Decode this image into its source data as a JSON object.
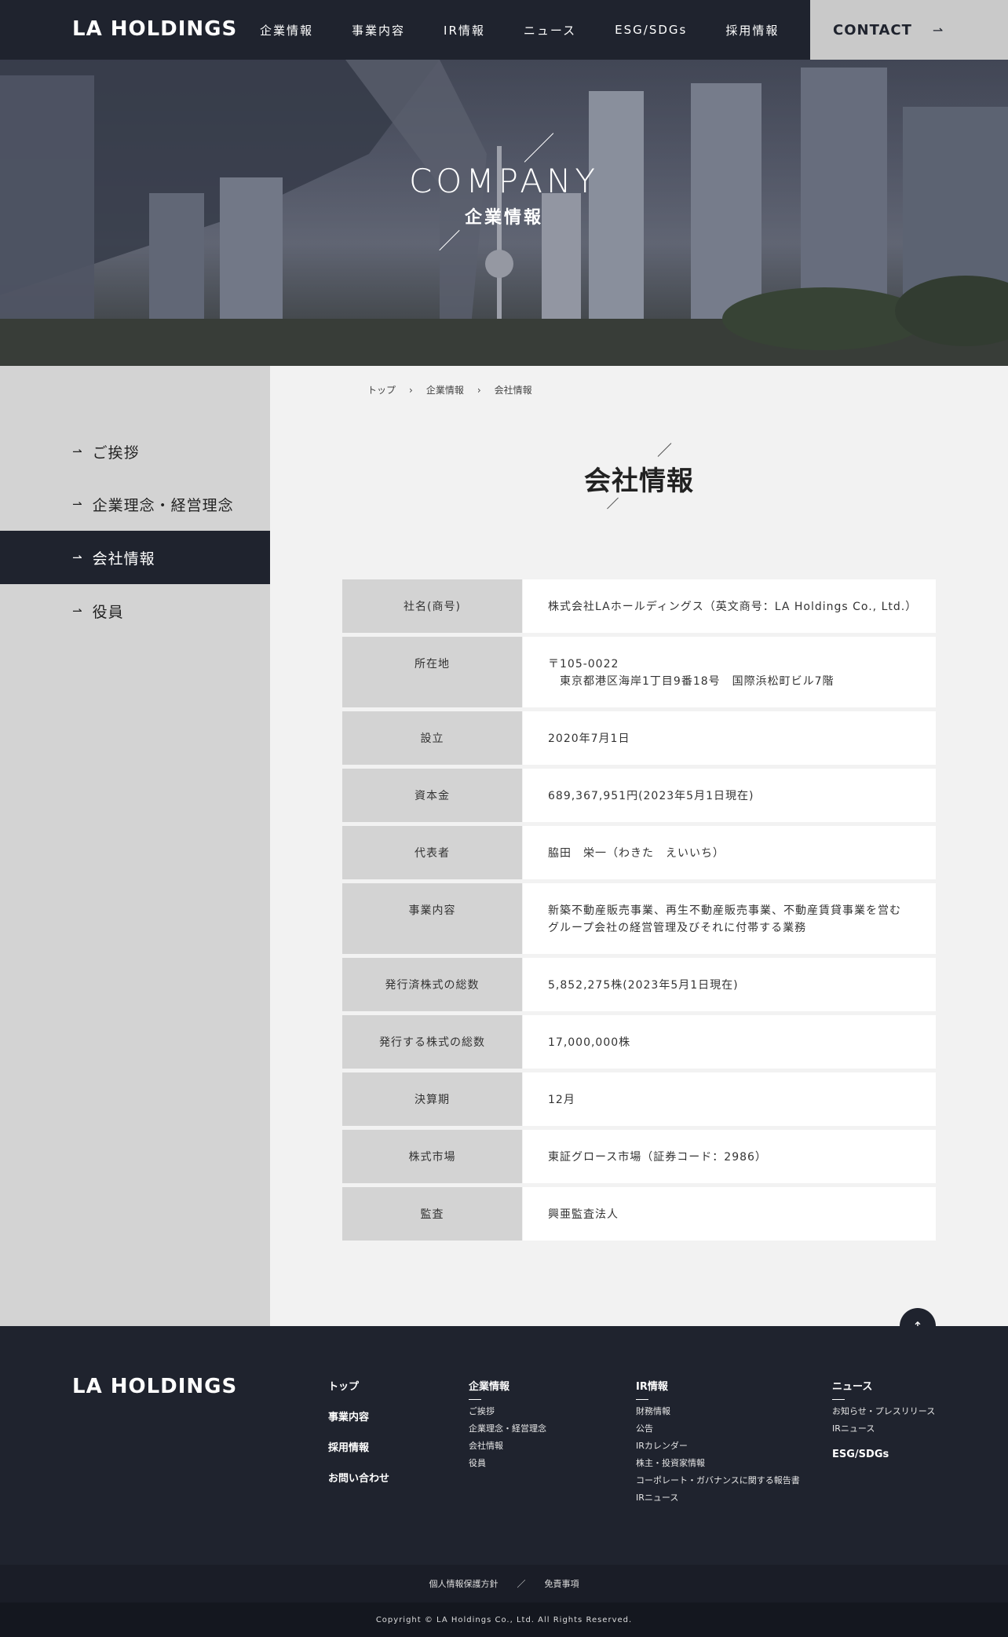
{
  "header": {
    "logo": "LA HOLDINGS",
    "nav": [
      "企業情報",
      "事業内容",
      "IR情報",
      "ニュース",
      "ESG/SDGs",
      "採用情報"
    ],
    "contact_label": "CONTACT",
    "contact_arrow": "⇀"
  },
  "hero": {
    "title": "COMPANY",
    "subtitle": "企業情報"
  },
  "sidebar": {
    "arrow": "⇀",
    "items": [
      {
        "label": "ご挨拶",
        "active": false
      },
      {
        "label": "企業理念・経営理念",
        "active": false
      },
      {
        "label": "会社情報",
        "active": true
      },
      {
        "label": "役員",
        "active": false
      }
    ]
  },
  "breadcrumb": {
    "items": [
      "トップ",
      "企業情報",
      "会社情報"
    ],
    "separator": "›"
  },
  "page_title": "会社情報",
  "company_table": {
    "rows": [
      {
        "label": "社名(商号)",
        "value": [
          "株式会社LAホールディングス（英文商号：LA Holdings Co., Ltd.）"
        ]
      },
      {
        "label": "所在地",
        "value": [
          "〒105-0022",
          "東京都港区海岸1丁目9番18号　国際浜松町ビル7階"
        ]
      },
      {
        "label": "設立",
        "value": [
          "2020年7月1日"
        ]
      },
      {
        "label": "資本金",
        "value": [
          "689,367,951円(2023年5月1日現在)"
        ]
      },
      {
        "label": "代表者",
        "value": [
          "脇田　栄一（わきた　えいいち）"
        ]
      },
      {
        "label": "事業内容",
        "value": [
          "新築不動産販売事業、再生不動産販売事業、不動産賃貸事業を営む",
          "グループ会社の経営管理及びそれに付帯する業務"
        ]
      },
      {
        "label": "発行済株式の総数",
        "value": [
          "5,852,275株(2023年5月1日現在)"
        ]
      },
      {
        "label": "発行する株式の総数",
        "value": [
          "17,000,000株"
        ]
      },
      {
        "label": "決算期",
        "value": [
          "12月"
        ]
      },
      {
        "label": "株式市場",
        "value": [
          "東証グロース市場（証券コード：2986）"
        ]
      },
      {
        "label": "監査",
        "value": [
          "興亜監査法人"
        ]
      }
    ]
  },
  "to_top_icon": "↑",
  "footer": {
    "logo": "LA HOLDINGS",
    "col1": [
      "トップ",
      "事業内容",
      "採用情報",
      "お問い合わせ"
    ],
    "col2": {
      "heading": "企業情報",
      "links": [
        "ご挨拶",
        "企業理念・経営理念",
        "会社情報",
        "役員"
      ]
    },
    "col3": {
      "heading": "IR情報",
      "links": [
        "財務情報",
        "公告",
        "IRカレンダー",
        "株主・投資家情報",
        "コーポレート・ガバナンスに関する報告書",
        "IRニュース"
      ]
    },
    "col4": {
      "heading": "ニュース",
      "links": [
        "お知らせ・プレスリリース",
        "IRニュース"
      ],
      "heading2": "ESG/SDGs"
    },
    "legal": [
      "個人情報保護方針",
      "免責事項"
    ],
    "legal_separator": "／",
    "copyright": "Copyright © LA Holdings Co., Ltd. All Rights Reserved."
  },
  "colors": {
    "navy": "#1f232e",
    "gray_panel": "#d3d3d3",
    "bg": "#f2f2f2"
  }
}
